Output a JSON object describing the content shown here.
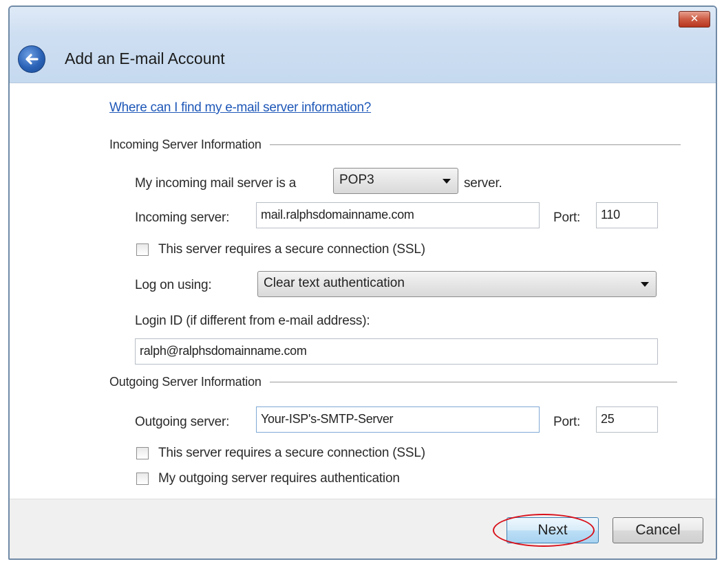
{
  "window": {
    "title": "Add an E-mail Account",
    "close_glyph": "✕",
    "back_icon": "back-arrow-icon"
  },
  "help_link": "Where can I find my e-mail server information?",
  "incoming": {
    "section_title": "Incoming Server Information",
    "server_type_prefix": "My incoming mail server is a",
    "server_type_value": "POP3",
    "server_type_suffix": "server.",
    "server_label": "Incoming server:",
    "server_value": "mail.ralphsdomainname.com",
    "port_label": "Port:",
    "port_value": "110",
    "ssl_label": "This server requires a secure connection (SSL)",
    "ssl_checked": false,
    "logon_label": "Log on using:",
    "logon_value": "Clear text authentication",
    "login_id_label": "Login ID (if different from e-mail address):",
    "login_id_value": "ralph@ralphsdomainname.com"
  },
  "outgoing": {
    "section_title": "Outgoing Server Information",
    "server_label": "Outgoing server:",
    "server_value": "Your-ISP's-SMTP-Server",
    "port_label": "Port:",
    "port_value": "25",
    "ssl_label": "This server requires a secure connection (SSL)",
    "ssl_checked": false,
    "auth_label": "My outgoing server requires authentication",
    "auth_checked": false
  },
  "footer": {
    "next_label": "Next",
    "cancel_label": "Cancel"
  },
  "colors": {
    "link": "#1f58b8",
    "highlight_ring": "#d8101a",
    "titlebar": "#cfdff2"
  }
}
